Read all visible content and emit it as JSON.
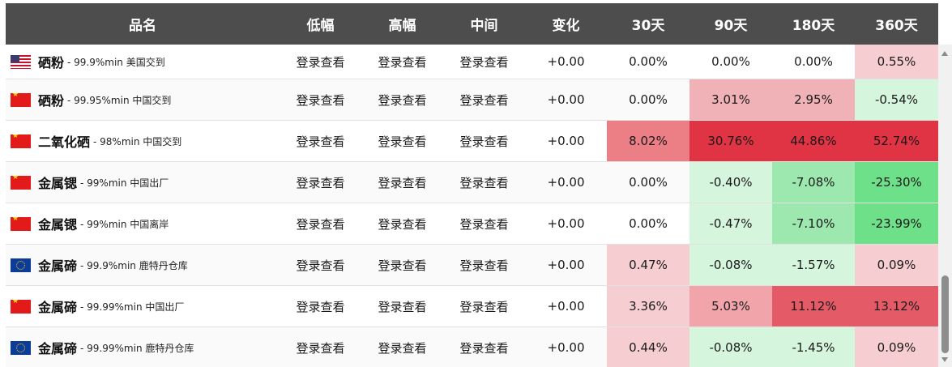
{
  "headers": {
    "name": "品名",
    "low": "低幅",
    "high": "高幅",
    "mid": "中间",
    "change": "变化",
    "d30": "30天",
    "d90": "90天",
    "d180": "180天",
    "d360": "360天"
  },
  "rows": [
    {
      "flag": "us-flag-icon",
      "name": "硒粉",
      "spec": "- 99.9%min 美国交到",
      "low": "登录查看",
      "high": "登录查看",
      "mid": "登录查看",
      "change": "+0.00",
      "d30": "0.00%",
      "d90": "0.00%",
      "d180": "0.00%",
      "d360": "0.55%"
    },
    {
      "flag": "cn-flag-icon",
      "name": "硒粉",
      "spec": "- 99.95%min 中国交到",
      "low": "登录查看",
      "high": "登录查看",
      "mid": "登录查看",
      "change": "+0.00",
      "d30": "0.00%",
      "d90": "3.01%",
      "d180": "2.95%",
      "d360": "-0.54%"
    },
    {
      "flag": "cn-flag-icon",
      "name": "二氧化硒",
      "spec": "- 98%min 中国交到",
      "low": "登录查看",
      "high": "登录查看",
      "mid": "登录查看",
      "change": "+0.00",
      "d30": "8.02%",
      "d90": "30.76%",
      "d180": "44.86%",
      "d360": "52.74%"
    },
    {
      "flag": "cn-flag-icon",
      "name": "金属锶",
      "spec": "- 99%min 中国出厂",
      "low": "登录查看",
      "high": "登录查看",
      "mid": "登录查看",
      "change": "+0.00",
      "d30": "0.00%",
      "d90": "-0.40%",
      "d180": "-7.08%",
      "d360": "-25.30%"
    },
    {
      "flag": "cn-flag-icon",
      "name": "金属锶",
      "spec": "- 99%min 中国离岸",
      "low": "登录查看",
      "high": "登录查看",
      "mid": "登录查看",
      "change": "+0.00",
      "d30": "0.00%",
      "d90": "-0.47%",
      "d180": "-7.10%",
      "d360": "-23.99%"
    },
    {
      "flag": "eu-flag-icon",
      "name": "金属碲",
      "spec": "- 99.9%min 鹿特丹仓库",
      "low": "登录查看",
      "high": "登录查看",
      "mid": "登录查看",
      "change": "+0.00",
      "d30": "0.47%",
      "d90": "-0.08%",
      "d180": "-1.57%",
      "d360": "0.09%"
    },
    {
      "flag": "cn-flag-icon",
      "name": "金属碲",
      "spec": "- 99.99%min 中国出厂",
      "low": "登录查看",
      "high": "登录查看",
      "mid": "登录查看",
      "change": "+0.00",
      "d30": "3.36%",
      "d90": "5.03%",
      "d180": "11.12%",
      "d360": "13.12%"
    },
    {
      "flag": "eu-flag-icon",
      "name": "金属碲",
      "spec": "- 99.99%min 鹿特丹仓库",
      "low": "登录查看",
      "high": "登录查看",
      "mid": "登录查看",
      "change": "+0.00",
      "d30": "0.44%",
      "d90": "-0.08%",
      "d180": "-1.45%",
      "d360": "0.09%"
    }
  ],
  "heat_colors": {
    "none": "#ffffff",
    "pos_light": "#f6cdd0",
    "pos_mid": "#f1b2b7",
    "pos_strong": "#ec7e86",
    "pos_max": "#e03343",
    "pos_high": "#e45a66",
    "neg_light": "#d5f5dc",
    "neg_mid": "#9ce8ae",
    "neg_strong": "#6ee08a"
  }
}
